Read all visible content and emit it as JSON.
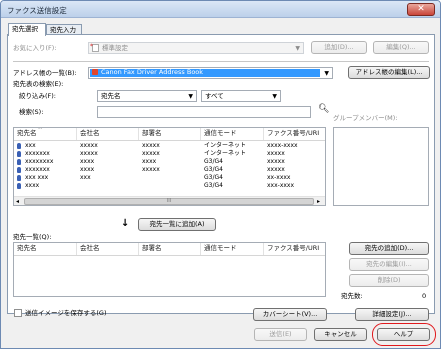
{
  "window": {
    "title": "ファクス送信設定",
    "close_glyph": "✕"
  },
  "tabs": [
    {
      "label": "宛先選択"
    },
    {
      "label": "宛先入力"
    }
  ],
  "favorites": {
    "label": "お気に入り(F):",
    "value": "標準設定",
    "add_button": "追加(D)...",
    "edit_button": "編集(Q)..."
  },
  "address_book": {
    "label": "アドレス帳の一覧(B):",
    "value": "Canon Fax Driver Address Book",
    "edit_button": "アドレス帳の編集(L)..."
  },
  "search": {
    "section_label": "宛先表の検索(E):",
    "filter_label": "絞り込み(F):",
    "filter_field_value": "宛先名",
    "filter_mode_value": "すべて",
    "search_label": "検索(S):",
    "search_value": "",
    "group_members_label": "グループメンバー(M):"
  },
  "destination_table": {
    "columns": [
      "宛先名",
      "会社名",
      "部署名",
      "通信モード",
      "ファクス番号/URI"
    ],
    "rows": [
      [
        "xxx",
        "xxxxx",
        "xxxxx",
        "インターネット",
        "xxxx-xxxx"
      ],
      [
        "xxxxxxx",
        "xxxxx",
        "xxxxx",
        "インターネット",
        "xxxxx"
      ],
      [
        "xxxxxxxx",
        "xxxx",
        "xxxx",
        "G3/G4",
        "xxxxx"
      ],
      [
        "xxxxxxx",
        "xxxx",
        "xxxxx",
        "G3/G4",
        "xxxxx"
      ],
      [
        "xxx xxx",
        "xxx",
        "",
        "G3/G4",
        "xx-xxxx"
      ],
      [
        "xxxx",
        "",
        "",
        "G3/G4",
        "xxx-xxxx"
      ]
    ],
    "scroll_glyph": "III"
  },
  "add_to_list_button": "宛先一覧に追加(A)",
  "recipient_list": {
    "label": "宛先一覧(Q):",
    "columns": [
      "宛先名",
      "会社名",
      "部署名",
      "通信モード",
      "ファクス番号/URI"
    ],
    "add_button": "宛先の追加(D)...",
    "edit_button": "宛先の編集(I)...",
    "delete_button": "削除(D)",
    "count_label": "宛先数:",
    "count_value": "0"
  },
  "save_image": {
    "label": "送信イメージを保存する(G)",
    "checked": false
  },
  "cover_sheet_button": "カバーシート(V)...",
  "advanced_button": "詳細設定(J)...",
  "footer": {
    "send_button": "送信(E)",
    "cancel_button": "キャンセル",
    "help_button": "ヘルプ"
  },
  "colors": {
    "highlight": "#3399ff",
    "help_circle": "#e0191d"
  }
}
